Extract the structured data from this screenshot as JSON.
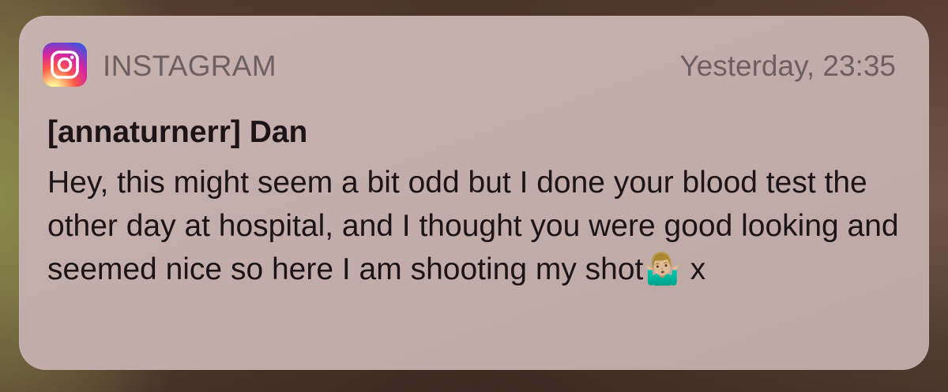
{
  "notification": {
    "app_icon": "instagram-icon",
    "app_name": "INSTAGRAM",
    "timestamp": "Yesterday, 23:35",
    "title": "[annaturnerr] Dan",
    "message": "Hey, this might seem a bit odd but I done your blood test the other day at hospital, and I thought you were good looking and seemed nice so here I am shooting my shot🤷🏼‍♂️ x"
  },
  "colors": {
    "card_background": "#c2adab",
    "header_text": "#6e5f60",
    "body_text": "#1c1416"
  }
}
